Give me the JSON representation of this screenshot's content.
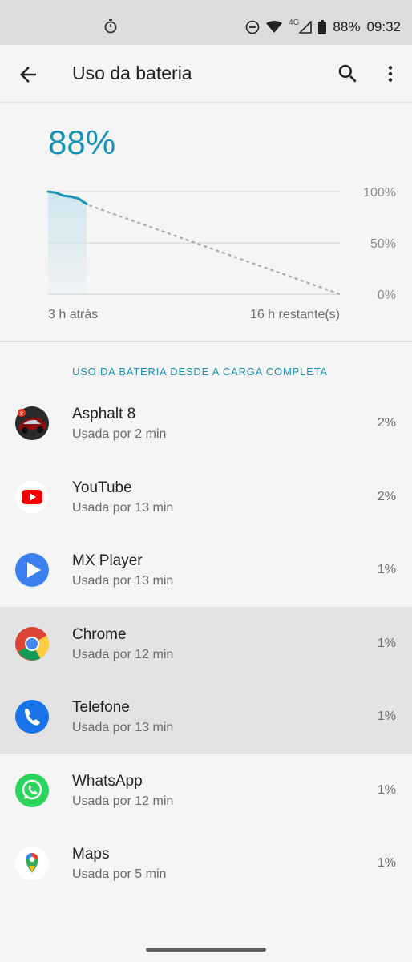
{
  "status_bar": {
    "icons": [
      "timer-icon",
      "do-not-disturb-icon",
      "wifi-icon",
      "signal-icon",
      "battery-icon"
    ],
    "network": "4G",
    "battery": "88%",
    "time": "09:32"
  },
  "app_bar": {
    "title": "Uso da bateria",
    "icons": [
      "back-arrow-icon",
      "search-icon",
      "more-vert-icon"
    ]
  },
  "battery": {
    "percent_text": "88%",
    "level": 88
  },
  "chart_data": {
    "type": "area",
    "x_labels": [
      "3 h atrás",
      "16 h restante(s)"
    ],
    "y_ticks": [
      "100%",
      "50%",
      "0%"
    ],
    "ylim": [
      0,
      100
    ],
    "grid": true,
    "series": [
      {
        "values": [
          100,
          99,
          96,
          95,
          93,
          88
        ]
      }
    ],
    "projection": {
      "from": 88,
      "to": 0
    }
  },
  "section": {
    "title": "USO DA BATERIA DESDE A CARGA COMPLETA"
  },
  "apps": [
    {
      "name": "Asphalt 8",
      "usage": "Usada por 2 min",
      "percent": "2%",
      "icon": "asphalt-8-icon",
      "highlighted": false
    },
    {
      "name": "YouTube",
      "usage": "Usada por 13 min",
      "percent": "2%",
      "icon": "youtube-icon",
      "highlighted": false
    },
    {
      "name": "MX Player",
      "usage": "Usada por 13 min",
      "percent": "1%",
      "icon": "mx-player-icon",
      "highlighted": false
    },
    {
      "name": "Chrome",
      "usage": "Usada por 12 min",
      "percent": "1%",
      "icon": "chrome-icon",
      "highlighted": true
    },
    {
      "name": "Telefone",
      "usage": "Usada por 13 min",
      "percent": "1%",
      "icon": "phone-icon",
      "highlighted": true
    },
    {
      "name": "WhatsApp",
      "usage": "Usada por 12 min",
      "percent": "1%",
      "icon": "whatsapp-icon",
      "highlighted": false
    },
    {
      "name": "Maps",
      "usage": "Usada por 5 min",
      "percent": "1%",
      "icon": "maps-icon",
      "highlighted": false
    }
  ],
  "colors": {
    "accent": "#1a92b3",
    "chart_fill": "#cfe6ee",
    "projection": "#a8b3bd"
  }
}
